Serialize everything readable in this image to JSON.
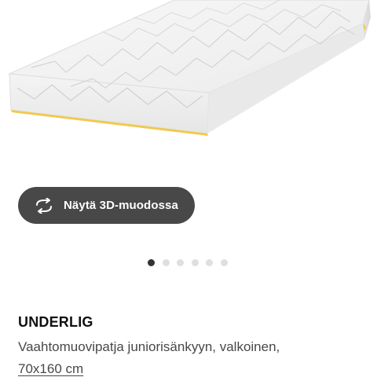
{
  "product": {
    "image_alt": "UNDERLIG mattress",
    "view_3d_label": "Näytä 3D-muodossa",
    "view_3d_icon": "rotate-3d-icon",
    "carousel": {
      "count": 6,
      "active_index": 0
    },
    "name": "UNDERLIG",
    "description": "Vaahtomuovipatja juniorisänkyyn, valkoinen,",
    "size": "70x160 cm"
  },
  "colors": {
    "button_bg": "#484848",
    "dot_active": "#333333",
    "dot_inactive": "#dfdfdf",
    "mattress_accent": "#f2c94c"
  }
}
